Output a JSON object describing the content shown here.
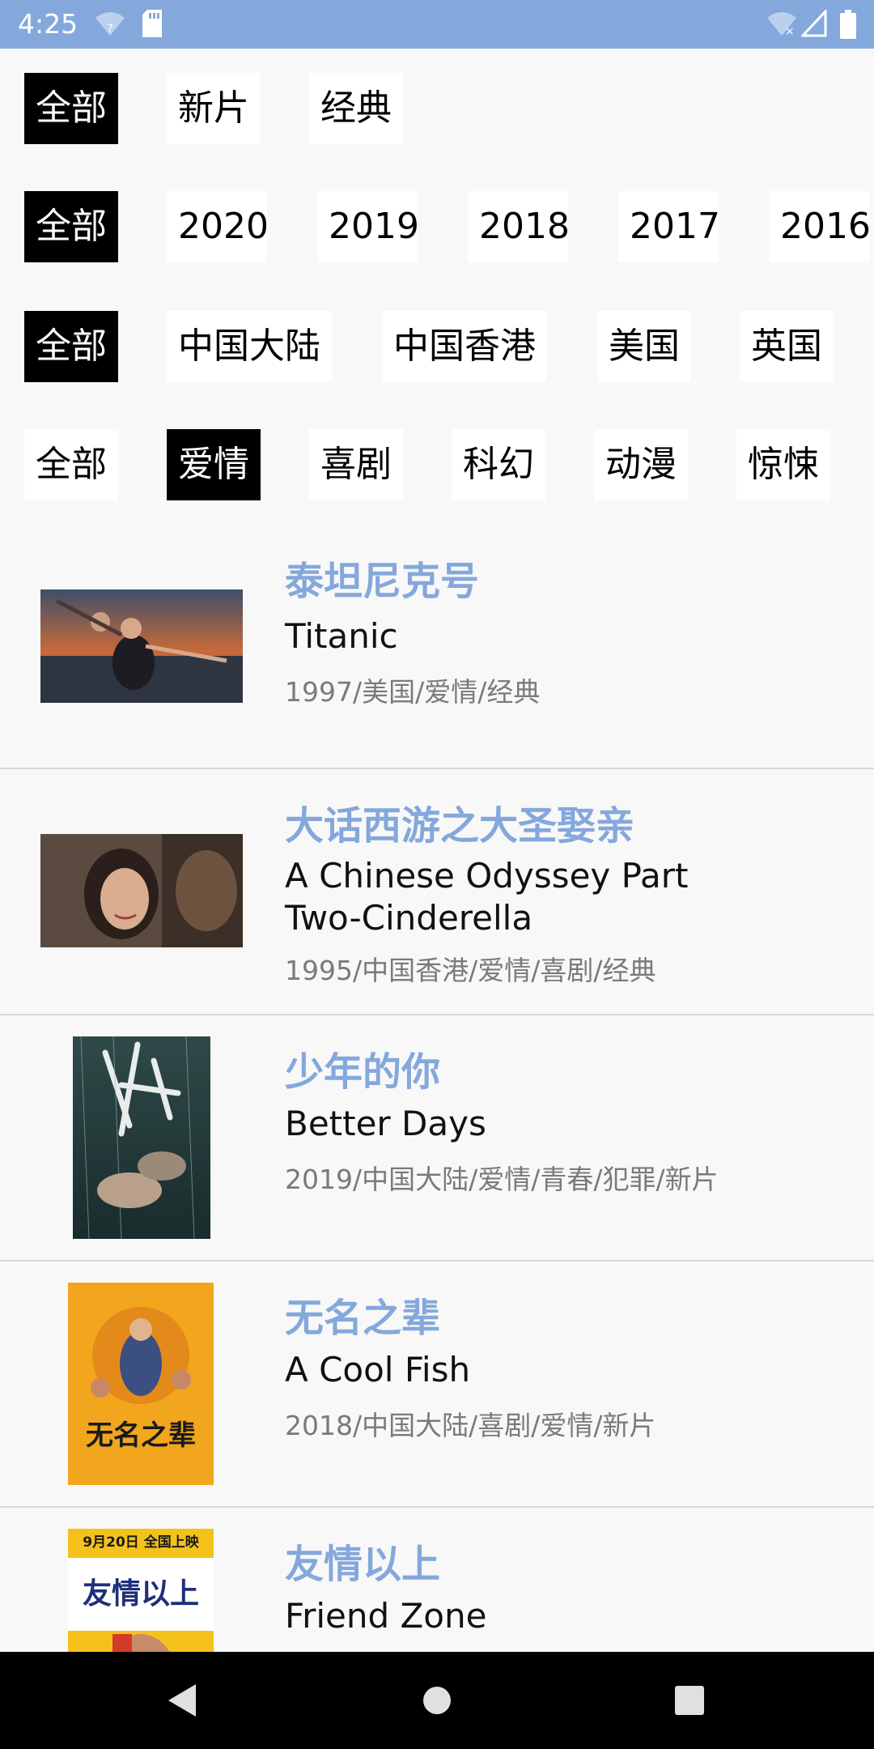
{
  "status_bar": {
    "time": "4:25"
  },
  "filters": {
    "type": [
      "全部",
      "新片",
      "经典"
    ],
    "year": [
      "全部",
      "2020",
      "2019",
      "2018",
      "2017",
      "2016"
    ],
    "region": [
      "全部",
      "中国大陆",
      "中国香港",
      "美国",
      "英国"
    ],
    "genre": [
      "全部",
      "爱情",
      "喜剧",
      "科幻",
      "动漫",
      "惊悚"
    ]
  },
  "selected": {
    "type": "全部",
    "year": "全部",
    "region": "全部",
    "genre": "爱情"
  },
  "movies": [
    {
      "title_cn": "泰坦尼克号",
      "title_en": "Titanic",
      "meta": "1997/美国/爱情/经典"
    },
    {
      "title_cn": "大话西游之大圣娶亲",
      "title_en": "A Chinese Odyssey Part Two-Cinderella",
      "meta": "1995/中国香港/爱情/喜剧/经典"
    },
    {
      "title_cn": "少年的你",
      "title_en": "Better Days",
      "meta": "2019/中国大陆/爱情/青春/犯罪/新片"
    },
    {
      "title_cn": "无名之辈",
      "title_en": "A Cool Fish",
      "meta": "2018/中国大陆/喜剧/爱情/新片",
      "poster_text": "无名之辈"
    },
    {
      "title_cn": "友情以上",
      "title_en": "Friend Zone",
      "meta": "",
      "poster_text": [
        "9月20日 全国上映",
        "友情以上"
      ]
    }
  ],
  "colors": {
    "accent": "#84a8dc",
    "status_bar": "#84a8dc",
    "selected_chip": "#000000"
  }
}
